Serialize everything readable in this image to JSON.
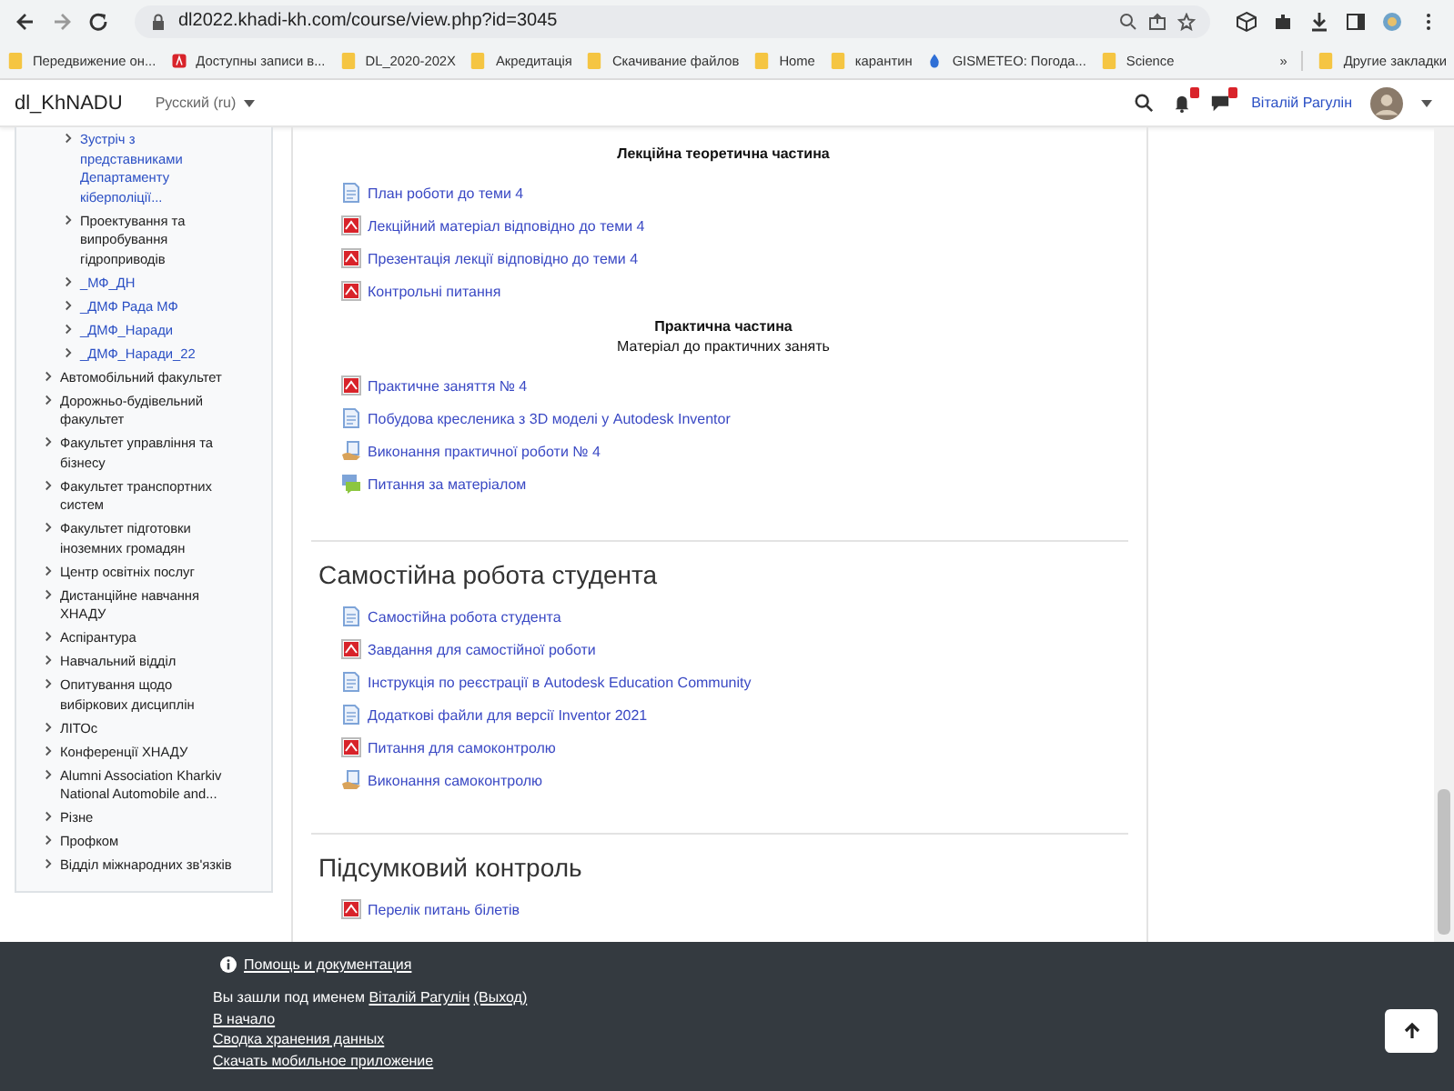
{
  "browser": {
    "url": "dl2022.khadi-kh.com/course/view.php?id=3045",
    "bookmarks": [
      {
        "label": "Передвижение он...",
        "kind": "folder"
      },
      {
        "label": "Доступны записи в...",
        "kind": "app"
      },
      {
        "label": "DL_2020-202X",
        "kind": "folder"
      },
      {
        "label": "Акредитація",
        "kind": "folder"
      },
      {
        "label": "Скачивание файлов",
        "kind": "folder"
      },
      {
        "label": "Home",
        "kind": "folder"
      },
      {
        "label": "карантин",
        "kind": "folder"
      },
      {
        "label": "GISMETEO: Погода...",
        "kind": "drop"
      },
      {
        "label": "Science",
        "kind": "folder"
      }
    ],
    "more": "»",
    "other_bookmarks": "Другие закладки"
  },
  "navbar": {
    "site": "dl_KhNADU",
    "language": "Русский (ru)",
    "user": "Віталій Рагулін",
    "notifications_badge": true,
    "messages_badge": true
  },
  "sidebar": {
    "nested_items": [
      {
        "label": "Зустріч з представниками Департаменту кіберполіції...",
        "link": true
      },
      {
        "label": "Проектування та випробування гідроприводів",
        "link": false
      },
      {
        "label": "_МФ_ДН",
        "link": true
      },
      {
        "label": "_ДМФ Рада МФ",
        "link": true
      },
      {
        "label": "_ДМФ_Наради",
        "link": true
      },
      {
        "label": "_ДМФ_Наради_22",
        "link": true
      }
    ],
    "items": [
      {
        "label": "Автомобільний факультет",
        "link": false
      },
      {
        "label": "Дорожньо-будівельний факультет",
        "link": false
      },
      {
        "label": "Факультет управління та бізнесу",
        "link": false
      },
      {
        "label": "Факультет транспортних систем",
        "link": false
      },
      {
        "label": "Факультет підготовки іноземних громадян",
        "link": false
      },
      {
        "label": "Центр освітніх послуг",
        "link": false
      },
      {
        "label": "Дистанційне навчання ХНАДУ",
        "link": false
      },
      {
        "label": "Аспірантура",
        "link": false
      },
      {
        "label": "Навчальний відділ",
        "link": false
      },
      {
        "label": "Опитування щодо вибіркових дисциплін",
        "link": false
      },
      {
        "label": "ЛІТОс",
        "link": false
      },
      {
        "label": "Конференції ХНАДУ",
        "link": false
      },
      {
        "label": "Alumni Association Kharkiv National Automobile and...",
        "link": false
      },
      {
        "label": "Різне",
        "link": false
      },
      {
        "label": "Профком",
        "link": false
      },
      {
        "label": "Відділ міжнародних зв'язків",
        "link": false
      }
    ]
  },
  "sections": [
    {
      "blocks": [
        {
          "heading": "Лекційна теоретична частина",
          "activities": [
            {
              "label": "План роботи до теми 4",
              "kind": "page"
            },
            {
              "label": "Лекційний матеріал відповідно до теми 4",
              "kind": "pdf"
            },
            {
              "label": "Презентація лекції відповідно до теми 4",
              "kind": "pdf"
            },
            {
              "label": "Контрольні питання",
              "kind": "pdf"
            }
          ]
        },
        {
          "heading": "Практична частина",
          "subheading": "Матеріал до практичних занять",
          "activities": [
            {
              "label": "Практичне заняття № 4",
              "kind": "pdf"
            },
            {
              "label": "Побудова кресленика з 3D моделі у Autodesk Inventor",
              "kind": "page"
            },
            {
              "label": "Виконання практичної роботи № 4",
              "kind": "assignment"
            },
            {
              "label": "Питання за матеріалом",
              "kind": "feedback"
            }
          ]
        }
      ]
    },
    {
      "title": "Самостійна робота студента",
      "blocks": [
        {
          "activities": [
            {
              "label": "Самостійна робота студента",
              "kind": "page"
            },
            {
              "label": "Завдання для самостійної роботи",
              "kind": "pdf"
            },
            {
              "label": "Інструкція по реєстрації в Autodesk Education Community",
              "kind": "page"
            },
            {
              "label": "Додаткові файли для версії Inventor 2021",
              "kind": "page"
            },
            {
              "label": "Питання для самоконтролю",
              "kind": "pdf"
            },
            {
              "label": "Виконання самоконтролю",
              "kind": "assignment"
            }
          ]
        }
      ]
    },
    {
      "title": "Підсумковий контроль",
      "blocks": [
        {
          "activities": [
            {
              "label": "Перелік питань білетів",
              "kind": "pdf"
            }
          ]
        }
      ]
    }
  ],
  "footer": {
    "help": "Помощь и документация",
    "logged_in_as": "Вы зашли под именем",
    "user": "Віталій Рагулін",
    "logout": "(Выход)",
    "links": [
      "В начало",
      "Сводка хранения данных",
      "Скачать мобильное приложение"
    ]
  }
}
